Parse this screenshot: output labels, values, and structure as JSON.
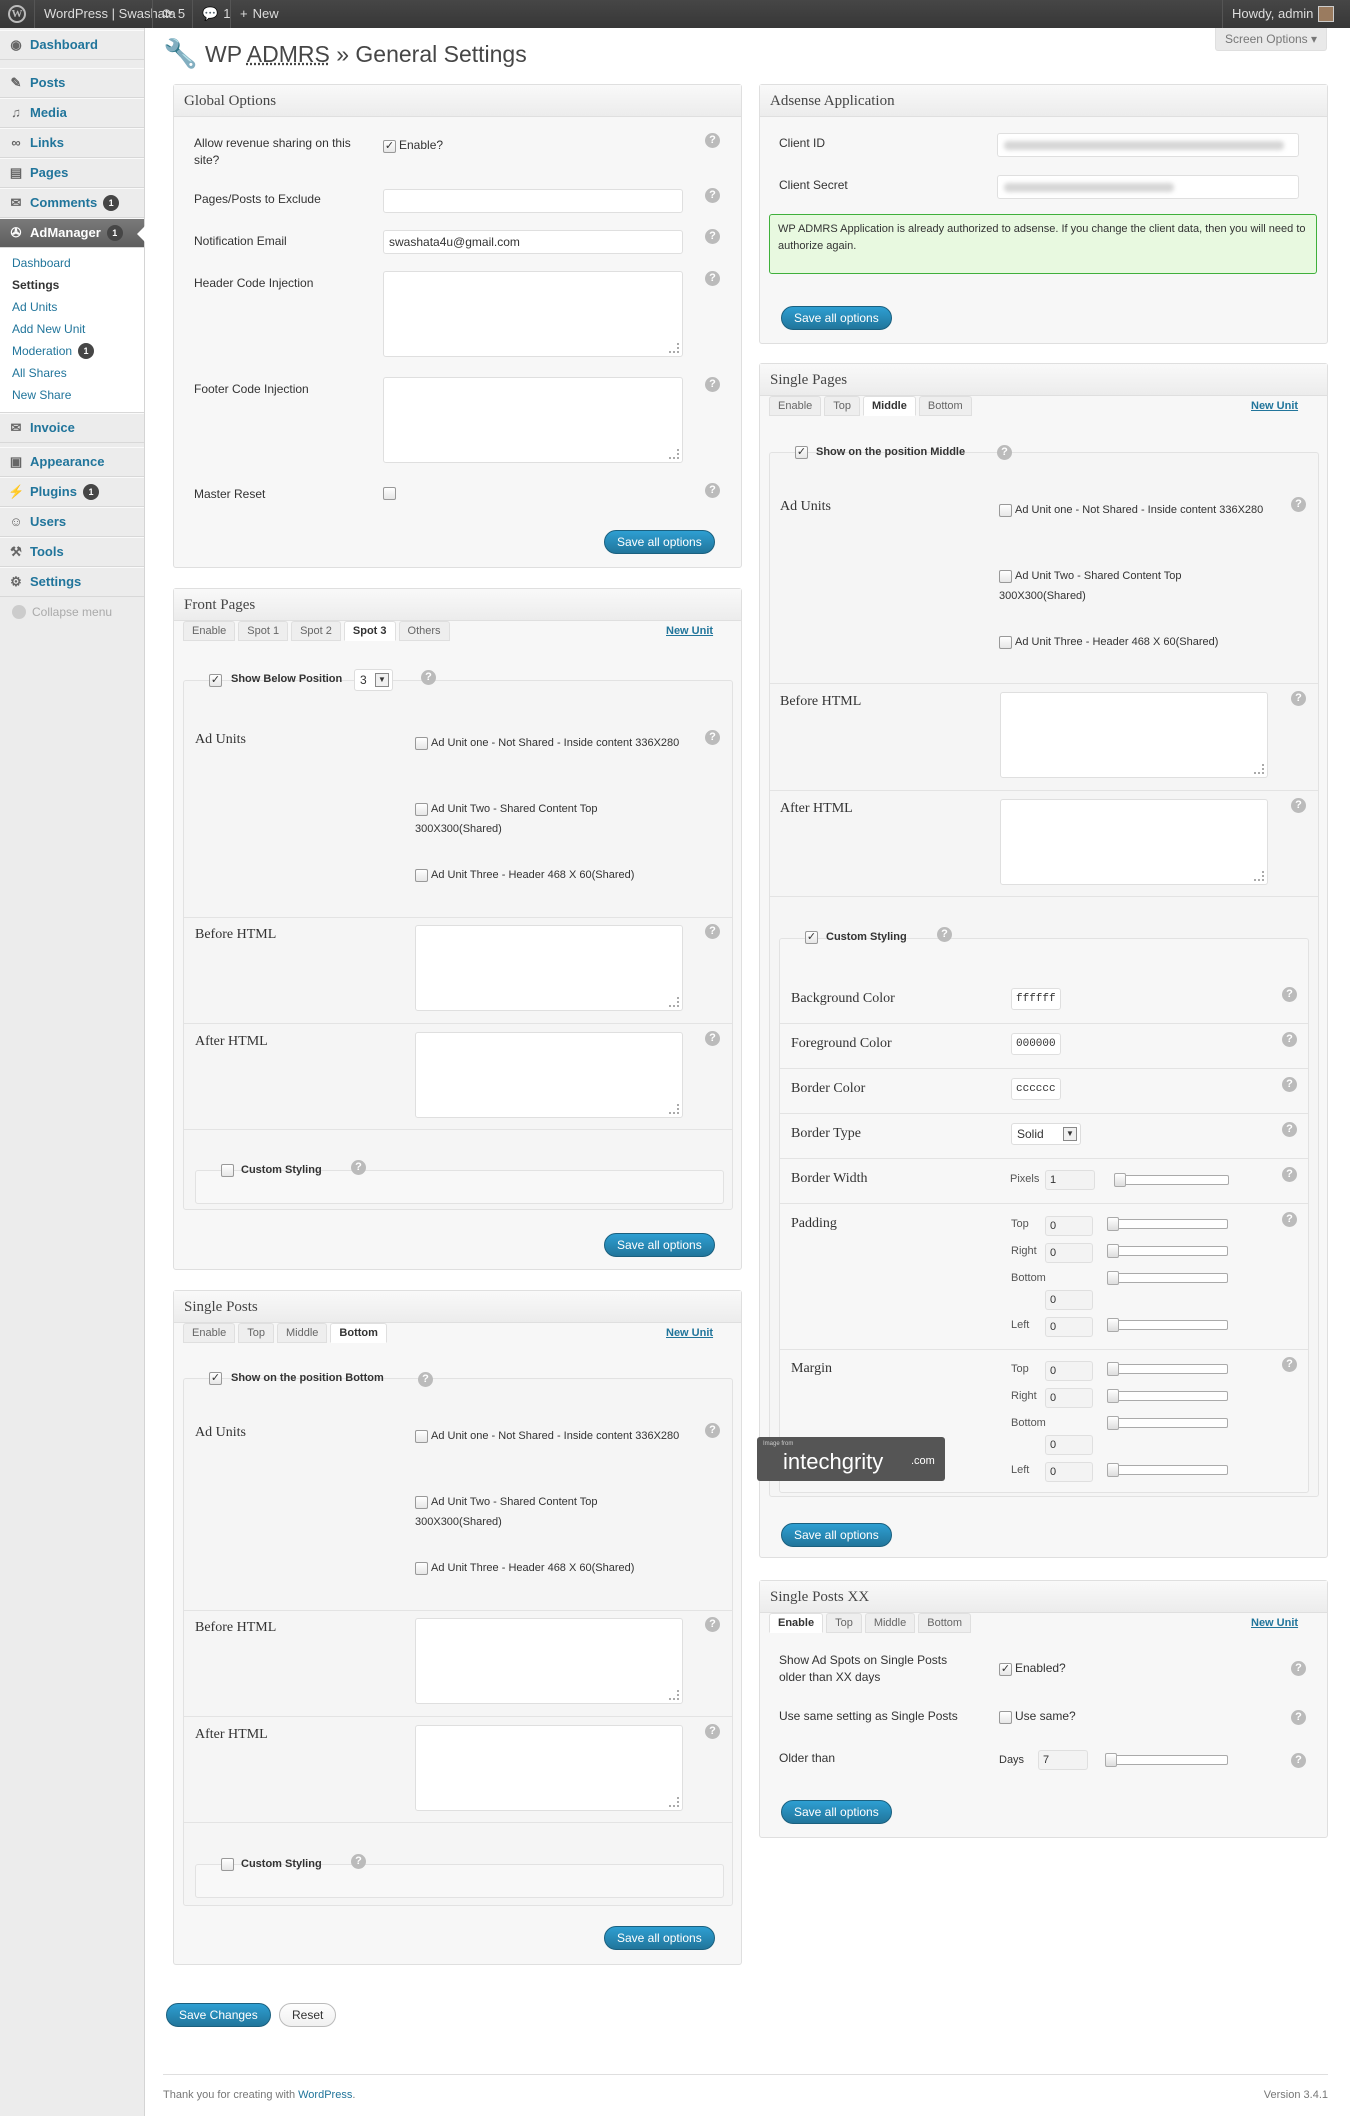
{
  "adminbar": {
    "site_name": "WordPress | Swashata",
    "updates_count": "5",
    "comments_count": "1",
    "new_label": "New",
    "howdy": "Howdy, admin"
  },
  "screen_options": "Screen Options",
  "page_title": {
    "prefix": "WP ",
    "abbr": "ADMRS",
    "suffix": " » General Settings"
  },
  "sidebar": {
    "items": [
      {
        "label": "Dashboard",
        "icon": "dashboard-icon"
      },
      {
        "label": "Posts",
        "icon": "pin-icon"
      },
      {
        "label": "Media",
        "icon": "media-icon"
      },
      {
        "label": "Links",
        "icon": "link-icon"
      },
      {
        "label": "Pages",
        "icon": "page-icon"
      },
      {
        "label": "Comments",
        "icon": "comment-icon",
        "badge": "1"
      },
      {
        "label": "AdManager",
        "icon": "admanager-icon",
        "badge": "1"
      },
      {
        "label": "Invoice",
        "icon": "invoice-icon"
      },
      {
        "label": "Appearance",
        "icon": "appearance-icon"
      },
      {
        "label": "Plugins",
        "icon": "plugin-icon",
        "badge": "1"
      },
      {
        "label": "Users",
        "icon": "users-icon"
      },
      {
        "label": "Tools",
        "icon": "tools-icon"
      },
      {
        "label": "Settings",
        "icon": "settings-icon"
      }
    ],
    "submenu": [
      "Dashboard",
      "Settings",
      "Ad Units",
      "Add New Unit",
      "Moderation",
      "All Shares",
      "New Share"
    ],
    "moderation_badge": "1",
    "collapse": "Collapse menu"
  },
  "global": {
    "title": "Global Options",
    "revenue_label": "Allow revenue sharing on this site?",
    "revenue_cb": "Enable?",
    "exclude_label": "Pages/Posts to Exclude",
    "email_label": "Notification Email",
    "email_value": "swashata4u@gmail.com",
    "header_label": "Header Code Injection",
    "footer_label": "Footer Code Injection",
    "reset_label": "Master Reset",
    "save": "Save all options"
  },
  "front": {
    "title": "Front Pages",
    "tabs": [
      "Enable",
      "Spot 1",
      "Spot 2",
      "Spot 3",
      "Others"
    ],
    "new_unit": "New Unit",
    "show_label": "Show Below Position",
    "position": "3",
    "ad_units_label": "Ad Units",
    "units": [
      "Ad Unit one - Not Shared - Inside content 336X280",
      "Ad Unit Two - Shared Content Top 300X300(Shared)",
      "Ad Unit Three - Header 468 X 60(Shared)"
    ],
    "before": "Before HTML",
    "after": "After HTML",
    "custom": "Custom Styling",
    "save": "Save all options"
  },
  "singleposts": {
    "title": "Single Posts",
    "tabs": [
      "Enable",
      "Top",
      "Middle",
      "Bottom"
    ],
    "new_unit": "New Unit",
    "show_label": "Show on the position Bottom",
    "ad_units_label": "Ad Units",
    "units": [
      "Ad Unit one - Not Shared - Inside content 336X280",
      "Ad Unit Two - Shared Content Top 300X300(Shared)",
      "Ad Unit Three - Header 468 X 60(Shared)"
    ],
    "before": "Before HTML",
    "after": "After HTML",
    "custom": "Custom Styling",
    "save": "Save all options"
  },
  "adsense": {
    "title": "Adsense Application",
    "client_id": "Client ID",
    "client_secret": "Client Secret",
    "notice": "WP ADMRS Application is already authorized to adsense. If you change the client data, then you will need to authorize again.",
    "save": "Save all options"
  },
  "singlepages": {
    "title": "Single Pages",
    "tabs": [
      "Enable",
      "Top",
      "Middle",
      "Bottom"
    ],
    "new_unit": "New Unit",
    "show_label": "Show on the position Middle",
    "ad_units_label": "Ad Units",
    "units": [
      "Ad Unit one - Not Shared - Inside content 336X280",
      "Ad Unit Two - Shared Content Top 300X300(Shared)",
      "Ad Unit Three - Header 468 X 60(Shared)"
    ],
    "before": "Before HTML",
    "after": "After HTML",
    "custom": "Custom Styling",
    "bg_label": "Background Color",
    "bg": "ffffff",
    "fg_label": "Foreground Color",
    "fg": "000000",
    "bc_label": "Border Color",
    "bc": "cccccc",
    "bt_label": "Border Type",
    "bt": "Solid",
    "bw_label": "Border Width",
    "pixels": "Pixels",
    "bw": "1",
    "padding_label": "Padding",
    "margin_label": "Margin",
    "top": "Top",
    "right": "Right",
    "bottom": "Bottom",
    "left": "Left",
    "zero": "0",
    "save": "Save all options"
  },
  "xx": {
    "title": "Single Posts XX",
    "tabs": [
      "Enable",
      "Top",
      "Middle",
      "Bottom"
    ],
    "new_unit": "New Unit",
    "show_label": "Show Ad Spots on Single Posts older than XX days",
    "enabled": "Enabled?",
    "same_label": "Use same setting as Single Posts",
    "same_cb": "Use same?",
    "older_label": "Older than",
    "days": "Days",
    "days_value": "7",
    "save": "Save all options"
  },
  "watermark": {
    "small": "Image from",
    "brand": "intechgrity",
    "tld": ".com"
  },
  "save_changes": "Save Changes",
  "reset": "Reset",
  "footer": {
    "text": "Thank you for creating with ",
    "link": "WordPress",
    "end": ".",
    "version": "Version 3.4.1"
  }
}
